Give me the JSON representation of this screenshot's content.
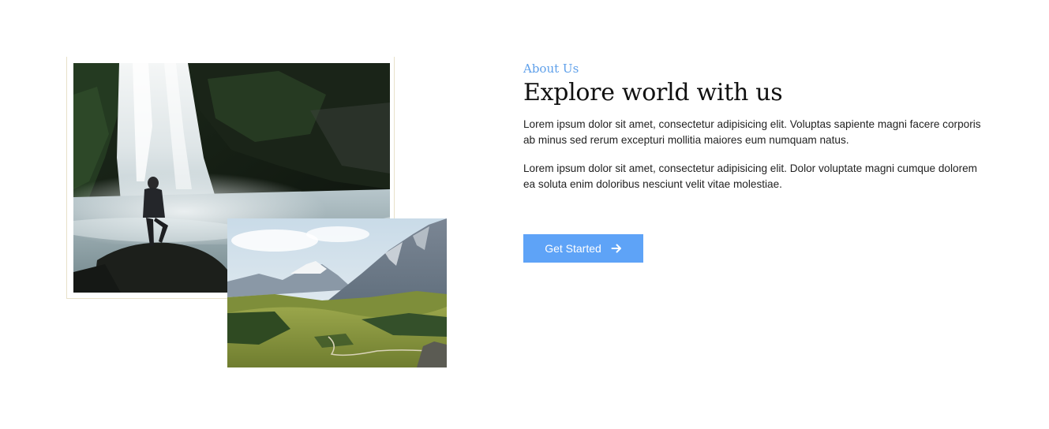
{
  "about": {
    "eyebrow": "About Us",
    "title": "Explore world with us",
    "paragraphs": [
      "Lorem ipsum dolor sit amet, consectetur adipisicing elit. Voluptas sapiente magni facere corporis ab minus sed rerum excepturi mollitia maiores eum numquam natus.",
      "Lorem ipsum dolor sit amet, consectetur adipisicing elit. Dolor voluptate magni cumque dolorem ea soluta enim doloribus nesciunt velit vitae molestiae."
    ],
    "cta": {
      "label": "Get Started",
      "icon": "arrow-right-icon"
    }
  },
  "images": [
    {
      "name": "waterfall-photo",
      "alt": ""
    },
    {
      "name": "mountain-valley-photo",
      "alt": ""
    }
  ],
  "colors": {
    "accent": "#5fa0ea",
    "button": "#5ea3f7",
    "frame_border": "#e8e1c9",
    "heading": "#111111",
    "body_text": "#222222"
  }
}
